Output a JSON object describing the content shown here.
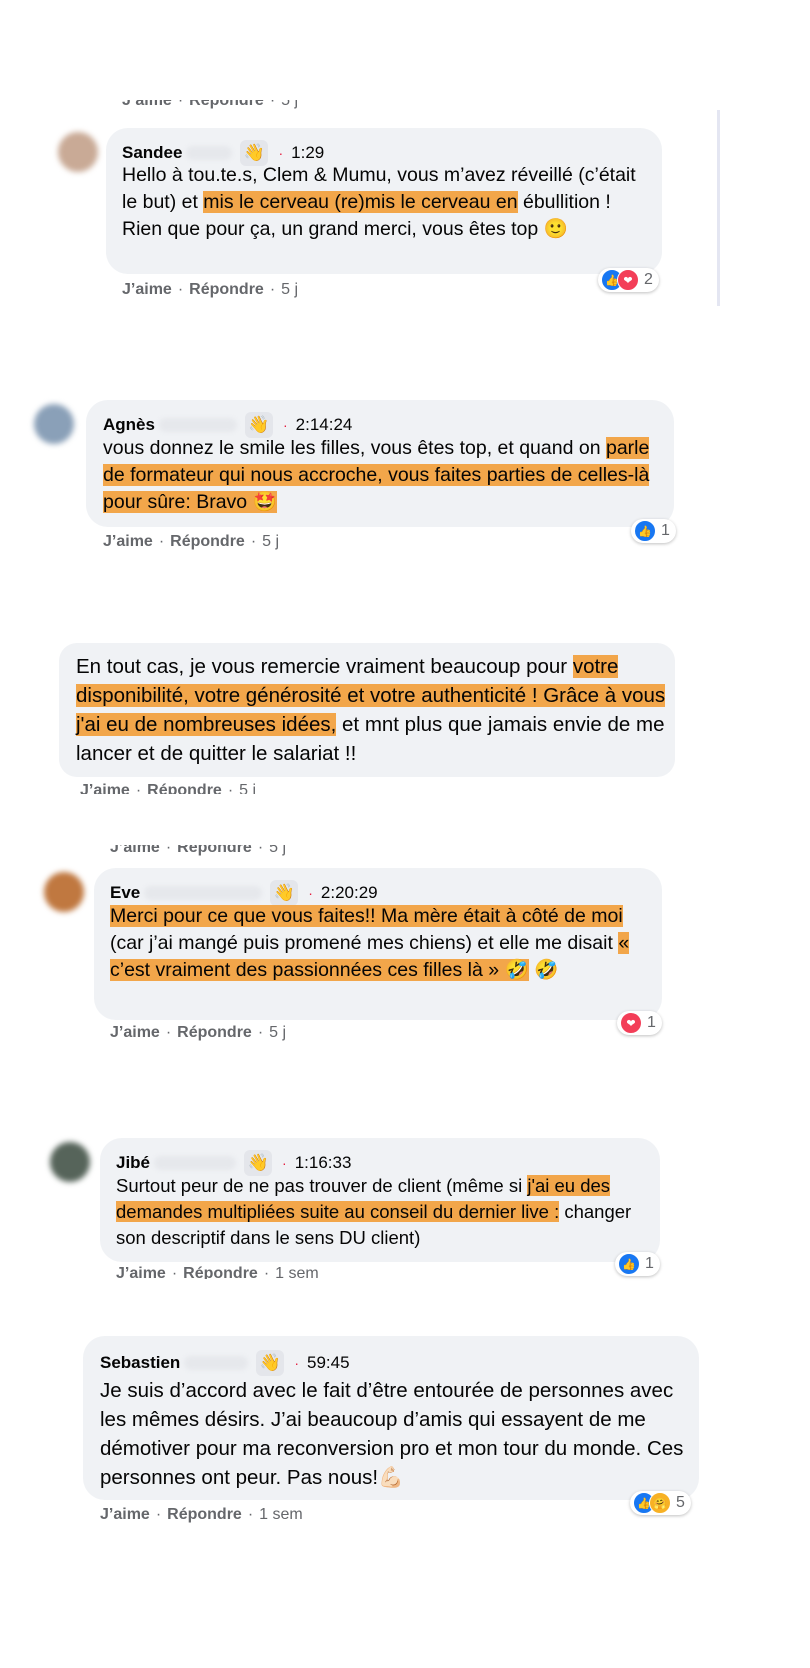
{
  "actions": {
    "like": "J’aime",
    "reply": "Répondre",
    "sep": "·"
  },
  "comments": [
    {
      "name": "Sandee",
      "time": "1:29",
      "age": "5 j",
      "reaction_count": "2",
      "text_plain1": "Hello à tou.te.s, Clem & Mumu, vous m’avez réveillé (c’était le but) et ",
      "text_hl1": "mis le cerveau (re)mis le cerveau en",
      "text_plain2": " ébullition ! Rien que pour ça, un grand merci, vous êtes top 🙂"
    },
    {
      "name": "Agnès",
      "time": "2:14:24",
      "age": "5 j",
      "reaction_count": "1",
      "text_plain1": "vous donnez le smile les filles, vous êtes top, et quand on ",
      "text_hl1": "parle de formateur qui nous accroche, vous faites parties de celles-là pour sûre: Bravo 🤩"
    },
    {
      "age": "5 j",
      "text_plain1": "En tout cas, je vous remercie vraiment beaucoup pour ",
      "text_hl1": "votre disponibilité, votre générosité et votre authenticité ! Grâce à vous j'ai eu de nombreuses idées,",
      "text_plain2": " et mnt plus que jamais envie de me lancer et de quitter le salariat !!"
    },
    {
      "name": "Eve",
      "time": "2:20:29",
      "age": "5 j",
      "reaction_count": "1",
      "text_hl1": "Merci pour ce que vous faites!! Ma mère était à côté de moi",
      "text_plain1": " (car j’ai mangé puis promené mes chiens) et elle me disait ",
      "text_hl2": "« c’est vraiment des passionnées ces filles là » 🤣",
      "text_plain2": " 🤣"
    },
    {
      "name": "Jibé",
      "time": "1:16:33",
      "age": "1 sem",
      "reaction_count": "1",
      "text_plain1": "Surtout peur de ne pas trouver de client (même si ",
      "text_hl1": "j'ai eu des demandes multipliées suite au conseil du dernier live :",
      "text_plain2": " changer son descriptif dans le sens DU client)"
    },
    {
      "name": "Sebastien",
      "time": "59:45",
      "age": "1 sem",
      "reaction_count": "5",
      "text_plain1": "Je suis d’accord avec le fait d’être entourée de personnes avec les mêmes désirs. J’ai beaucoup d’amis qui essayent de me démotiver pour ma reconversion pro et mon tour du monde. Ces personnes ont peur. Pas nous!💪🏻"
    }
  ],
  "icons": {
    "wave": "👋",
    "like": "👍",
    "love": "❤",
    "care": "🤗"
  },
  "colors": {
    "highlight": "#f2a64a",
    "bubble": "#f0f2f5",
    "like": "#1877f2",
    "love": "#f33e58"
  }
}
